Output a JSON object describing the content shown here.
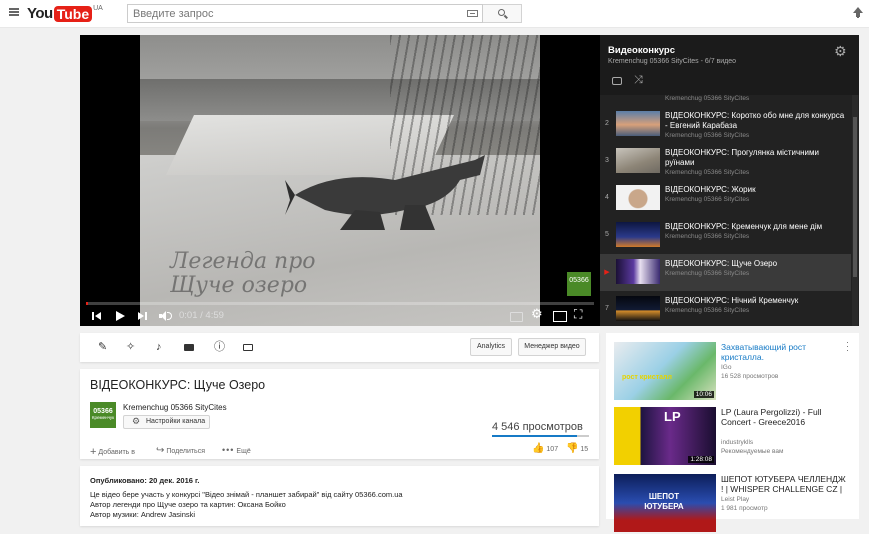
{
  "masthead": {
    "logo_you": "You",
    "logo_tube": "Tube",
    "logo_country": "UA",
    "search_placeholder": "Введите запрос"
  },
  "player": {
    "time": "0:01 / 4:59",
    "progress_fraction": 0.003,
    "badge": "05366",
    "overlay_caption_line1": "Легенда про",
    "overlay_caption_line2": "Щуче озеро"
  },
  "playlist": {
    "title": "Видеоконкурс",
    "subtitle": "Kremenchug 05366 SityCites - 6/7 видео",
    "items": [
      {
        "index": "",
        "title": "",
        "channel": "Kremenchug 05366 SityCites"
      },
      {
        "index": "2",
        "title": "ВІДЕОКОНКУРС: Коротко обо мне для конкурса - Евгений Карабаза",
        "channel": "Kremenchug 05366 SityCites"
      },
      {
        "index": "3",
        "title": "ВІДЕОКОНКУРС: Прогулянка містичними руїнами",
        "channel": "Kremenchug 05366 SityCites"
      },
      {
        "index": "4",
        "title": "ВІДЕОКОНКУРС: Жорик",
        "channel": "Kremenchug 05366 SityCites"
      },
      {
        "index": "5",
        "title": "ВІДЕОКОНКУРС: Кременчук для мене дім",
        "channel": "Kremenchug 05366 SityCites"
      },
      {
        "index": "▶",
        "title": "ВІДЕОКОНКУРС: Щуче Озеро",
        "channel": "Kremenchug 05366 SityCites"
      },
      {
        "index": "7",
        "title": "ВІДЕОКОНКУРС: Нічний Кременчук",
        "channel": "Kremenchug 05366 SityCites"
      }
    ]
  },
  "actionbar": {
    "analytics": "Analytics",
    "video_manager": "Менеджер видео"
  },
  "video": {
    "title": "ВІДЕОКОНКУРС: Щуче Озеро",
    "channel_logo": "05366",
    "channel_logo_small": "Кременчук",
    "channel_name": "Kremenchug 05366 SityCites",
    "channel_settings": "Настройки канала",
    "views": "4 546 просмотров",
    "like_fraction": 0.877,
    "add_to": "Добавить в",
    "share": "Поделиться",
    "more": "Ещё",
    "likes": "107",
    "dislikes": "15"
  },
  "description": {
    "published": "Опубликовано: 20 дек. 2016 г.",
    "lines": [
      "Це відео бере участь у конкурсі \"Відео знімай - планшет забирай\" від сайту 05366.com.ua",
      "Автор легенди про Щуче озеро та картин: Оксана Бойко",
      "Автор музики: Andrew Jasinski"
    ]
  },
  "recommended": [
    {
      "title": "Захватывающий рост кристалла.",
      "channel": "IGo",
      "meta": "16 528 просмотров",
      "duration": "10:06",
      "thumb_text": "рост кристалл"
    },
    {
      "title": "LP (Laura Pergolizzi) - Full Concert - Greece2016",
      "channel": "industryklls",
      "meta": "Рекомендуемые вам",
      "duration": "1:28:08",
      "thumb_text": "LP"
    },
    {
      "title": "ШЕПОТ ЮТУБЕРА ЧЕЛЛЕНДЖ ! | WHISPER CHALLENGE CZ |",
      "channel": "Leist Play",
      "meta": "1 981 просмотр",
      "duration": "",
      "thumb_text": "ШЕПОТ ЮТУБЕРА"
    }
  ]
}
